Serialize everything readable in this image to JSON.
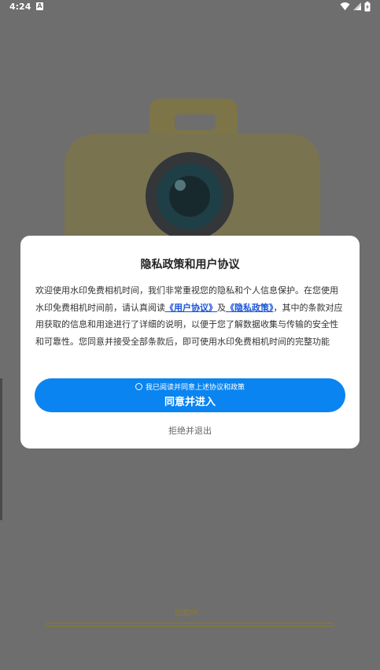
{
  "status_bar": {
    "time": "4:24",
    "notification_icon": "A",
    "icons": [
      "wifi-icon",
      "signal-icon",
      "battery-icon"
    ]
  },
  "splash": {
    "loading_text": "加载中..."
  },
  "dialog": {
    "title": "隐私政策和用户协议",
    "body": {
      "part1": "欢迎使用水印免费相机时间，我们非常重视您的隐私和个人信息保护。在您使用水印免费相机时间前，请认真阅读",
      "link_user_agreement": "《用户协议》",
      "and": "及",
      "link_privacy_policy": "《隐私政策》",
      "part2": "，其中的条款对应用获取的信息和用途进行了详细的说明，以便于您了解数据收集与传输的安全性和可靠性。您同意并接受全部条款后，即可使用水印免费相机时间的完整功能"
    },
    "checkbox_label": "我已阅读并同意上述协议和政策",
    "agree_button": "同意并进入",
    "reject_button": "拒绝并退出"
  },
  "colors": {
    "overlay": "#6e6e6e",
    "accent": "#0a84f0",
    "link": "#1a53d6",
    "camera_body": "#7d7448"
  }
}
